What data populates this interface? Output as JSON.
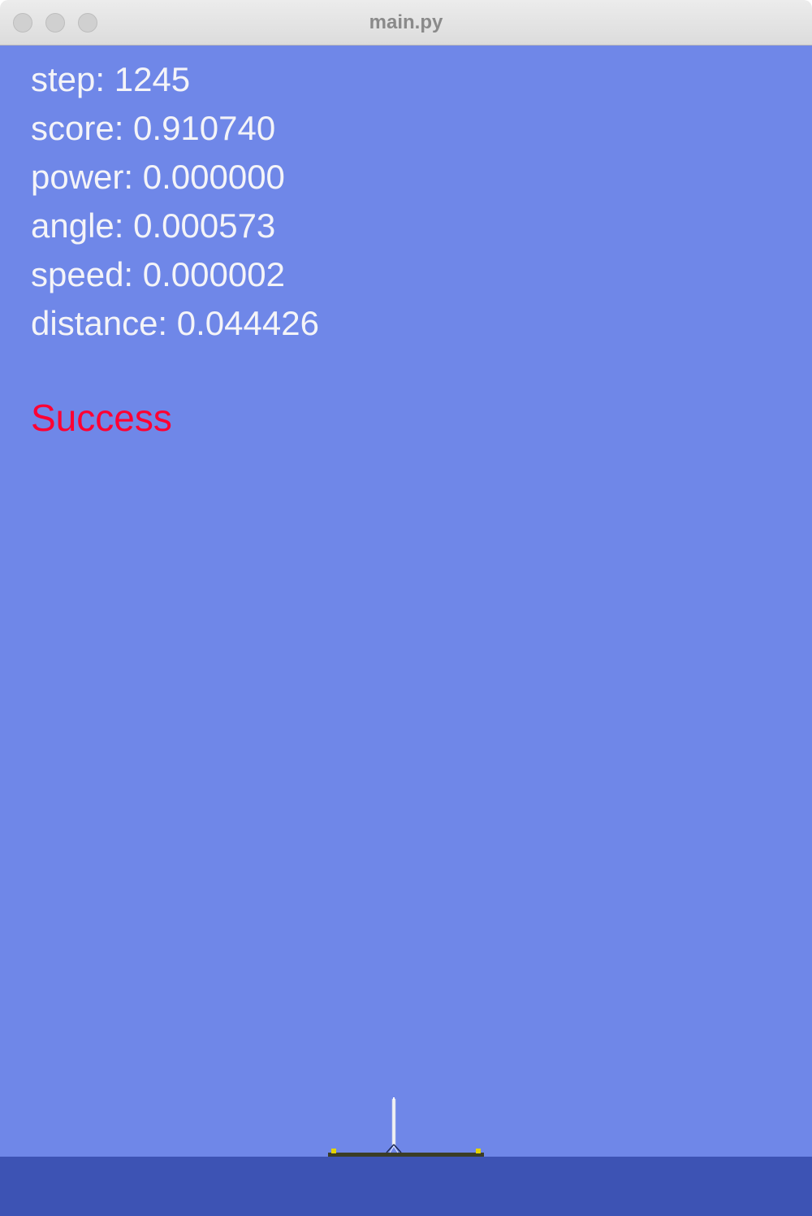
{
  "window": {
    "title": "main.py"
  },
  "hud": {
    "step": "step: 1245",
    "score": "score: 0.910740",
    "power": "power: 0.000000",
    "angle": "angle: 0.000573",
    "speed": "speed: 0.000002",
    "distance": "distance: 0.044426"
  },
  "status": {
    "text": "Success",
    "color": "#ff0033"
  },
  "colors": {
    "sky": "#6f87e8",
    "ground": "#3d53b4",
    "landing_pad": "#3b3d26",
    "pad_markers": "#e3d300",
    "rocket_body": "#f2f2f2"
  },
  "icons": {
    "rocket": "rocket-icon",
    "close": "close-icon",
    "minimize": "minimize-icon",
    "zoom": "zoom-icon"
  }
}
